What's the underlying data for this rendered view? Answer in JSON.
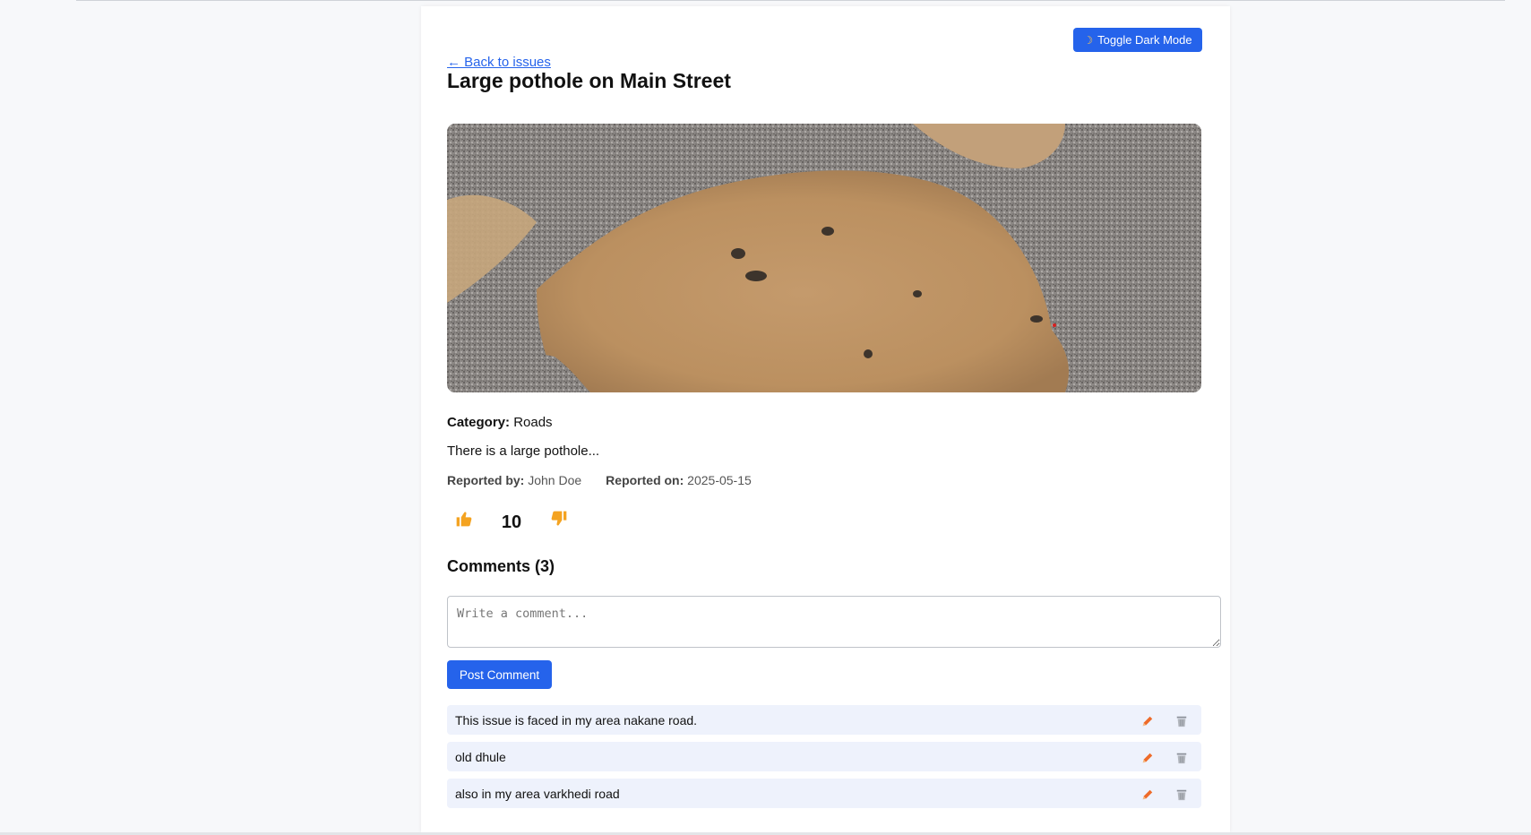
{
  "header": {
    "dark_mode_label": "Toggle Dark Mode",
    "back_link": "← Back to issues"
  },
  "issue": {
    "title": "Large pothole on Main Street",
    "category_label": "Category:",
    "category": "Roads",
    "description": "There is a large pothole...",
    "reported_by_label": "Reported by:",
    "reported_by": "John Doe",
    "reported_on_label": "Reported on:",
    "reported_on": "2025-05-15",
    "vote_count": "10"
  },
  "comments": {
    "heading": "Comments (3)",
    "input_placeholder": "Write a comment...",
    "post_label": "Post Comment",
    "items": [
      {
        "text": "This issue is faced in my area nakane road."
      },
      {
        "text": "old dhule"
      },
      {
        "text": "also in my area varkhedi road"
      }
    ]
  },
  "icons": {
    "dark_mode": "moon-icon",
    "upvote": "thumbs-up-icon",
    "downvote": "thumbs-down-icon",
    "edit": "pencil-icon",
    "delete": "trash-icon"
  },
  "colors": {
    "accent": "#2563eb",
    "comment_bg": "#eef2fc",
    "edit_icon": "#ee6b2a",
    "delete_icon": "#8a8f98"
  }
}
